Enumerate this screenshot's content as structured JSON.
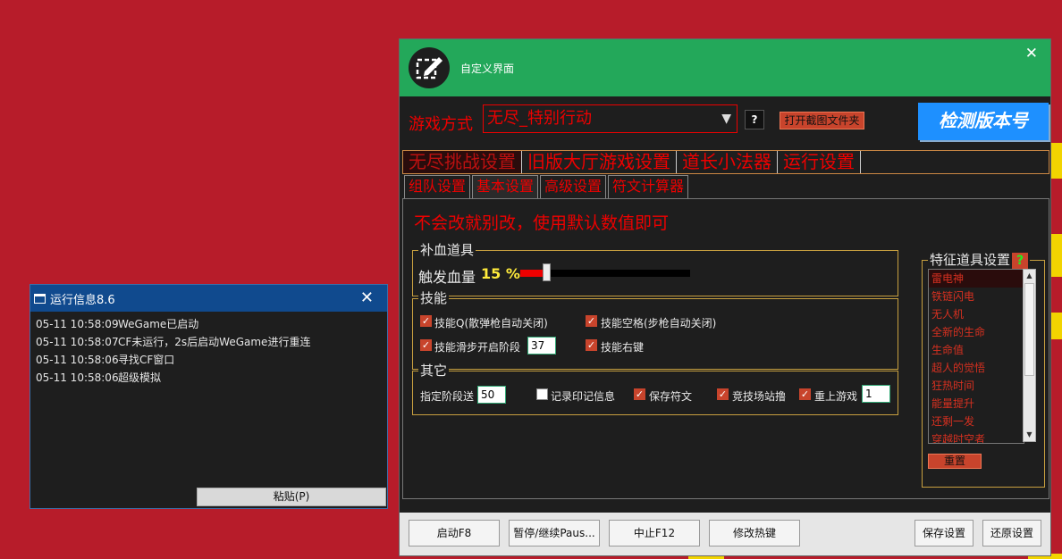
{
  "log_window": {
    "title": "运行信息8.6",
    "close_glyph": "✕",
    "lines": [
      {
        "time": "05-11 10:58:09",
        "message": "WeGame已启动"
      },
      {
        "time": "05-11 10:58:07",
        "message": "CF未运行，2s后启动WeGame进行重连"
      },
      {
        "time": "05-11 10:58:06",
        "message": "寻找CF窗口"
      },
      {
        "time": "05-11 10:58:06",
        "message": "超级模拟"
      }
    ],
    "paste_label": "粘贴(P)"
  },
  "main_window": {
    "title": "自定义界面",
    "close_glyph": "✕",
    "mode_label": "游戏方式",
    "mode_value": "无尽_特别行动",
    "help_label": "?",
    "open_folder_label": "打开截图文件夹",
    "check_version_label": "检测版本号",
    "main_tabs": [
      "无尽挑战设置",
      "旧版大厅游戏设置",
      "道长小法器",
      "运行设置"
    ],
    "sub_tabs": [
      "组队设置",
      "基本设置",
      "高级设置",
      "符文计算器"
    ],
    "warning": "不会改就别改，使用默认数值即可",
    "heal_group": {
      "title": "补血道具",
      "trigger_label": "触发血量",
      "trigger_value": "15 %",
      "trigger_fraction": 0.15
    },
    "skill_group": {
      "title": "技能",
      "q_label": "技能Q(散弹枪自动关闭)",
      "space_label": "技能空格(步枪自动关闭)",
      "slide_label": "技能滑步开启阶段",
      "slide_value": "37",
      "right_label": "技能右键"
    },
    "other_group": {
      "title": "其它",
      "stage_label": "指定阶段送",
      "stage_value": "50",
      "record_label": "记录印记信息",
      "save_rune_label": "保存符文",
      "arena_label": "竞技场站撸",
      "restart_label": "重上游戏",
      "restart_value": "1"
    },
    "feature_panel": {
      "title": "特征道具设置",
      "help_label": "?",
      "items": [
        "雷电神",
        "铁链闪电",
        "无人机",
        "全新的生命",
        "生命值",
        "超人的觉悟",
        "狂热时间",
        "能量提升",
        "还剩一发",
        "穿越时空者"
      ],
      "reset_label": "重置"
    },
    "bottom_buttons": {
      "start": "启动F8",
      "pause": "暂停/继续Paus...",
      "stop": "中止F12",
      "hotkey": "修改热键",
      "save": "保存设置",
      "restore": "还原设置"
    }
  }
}
